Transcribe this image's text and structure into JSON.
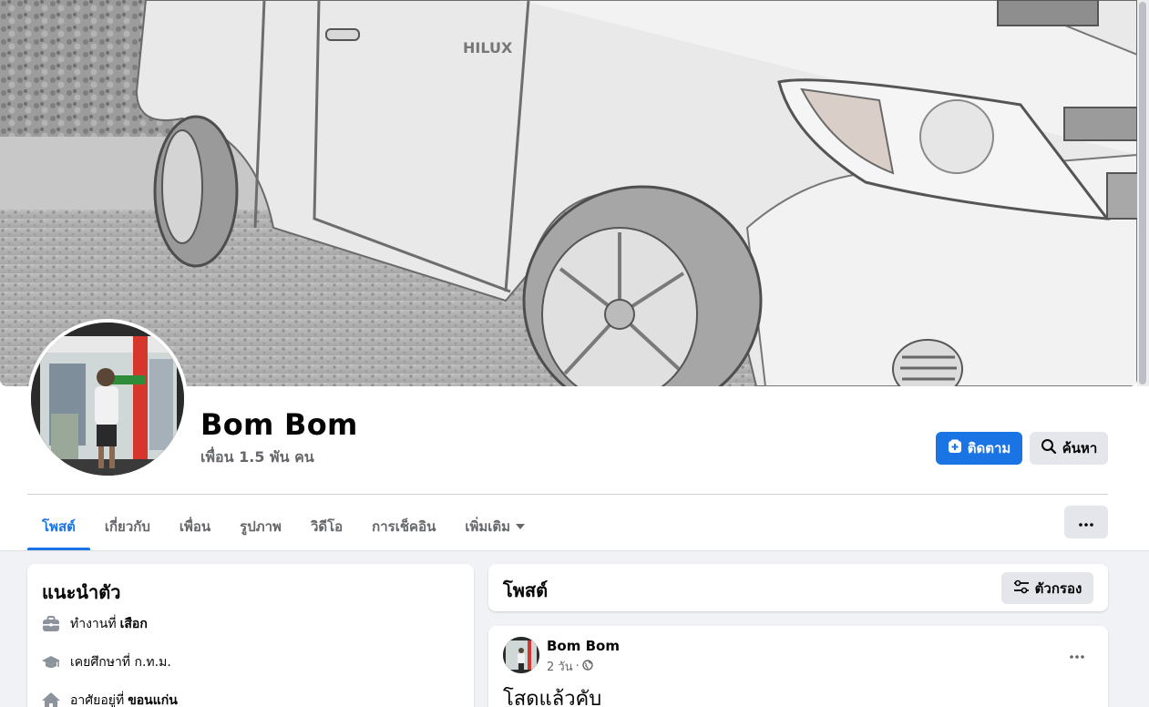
{
  "profile": {
    "name": "Bom Bom",
    "friends": "เพื่อน 1.5 พัน คน"
  },
  "actions": {
    "follow_label": "ติดตาม",
    "search_label": "ค้นหา"
  },
  "tabs": [
    {
      "label": "โพสต์",
      "active": true
    },
    {
      "label": "เกี่ยวกับ"
    },
    {
      "label": "เพื่อน"
    },
    {
      "label": "รูปภาพ"
    },
    {
      "label": "วิดีโอ"
    },
    {
      "label": "การเช็คอิน"
    },
    {
      "label": "เพิ่มเติม"
    }
  ],
  "intro": {
    "title": "แนะนำตัว",
    "items": [
      {
        "icon": "briefcase-icon",
        "prefix": "ทำงานที่",
        "value": "เสือก"
      },
      {
        "icon": "graduation-cap-icon",
        "prefix": "เคยศึกษาที่ ก.ท.ม.",
        "value": ""
      },
      {
        "icon": "home-icon",
        "prefix": "อาศัยอยู่ที่",
        "value": "ขอนแก่น"
      }
    ]
  },
  "posts_section": {
    "title": "โพสต์",
    "filter_label": "ตัวกรอง"
  },
  "post": {
    "author": "Bom Bom",
    "time": "2 วัน",
    "separator": "·",
    "privacy_icon": "globe-icon",
    "text": "โสดแล้วคับ"
  },
  "colors": {
    "accent": "#1b74e4",
    "secondary_button": "#e4e6eb",
    "page_background": "#f0f2f5",
    "muted_text": "#65676b"
  }
}
